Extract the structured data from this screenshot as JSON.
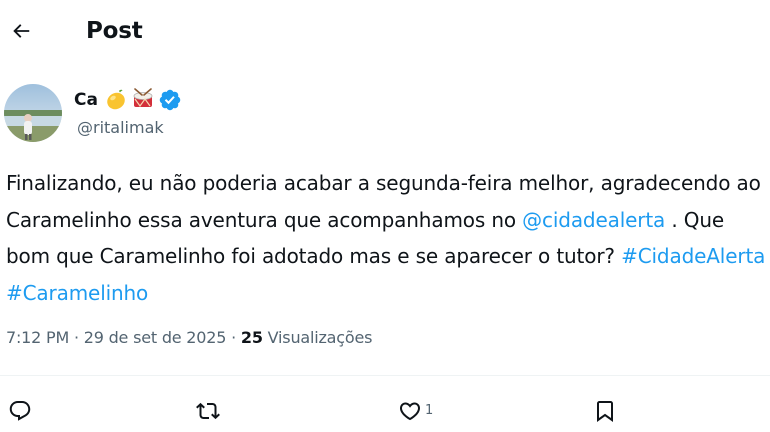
{
  "header": {
    "back_icon": "arrow-left-icon",
    "title": "Post"
  },
  "author": {
    "display_name": "Ca",
    "emojis": [
      "lemon-icon",
      "drum-icon"
    ],
    "verified_icon": "verified-badge-icon",
    "handle": "@ritalimak"
  },
  "post": {
    "text_before_mention": "Finalizando,  eu não poderia acabar a segunda-feira melhor, agradecendo ao Caramelinho essa aventura que acompanhamos no ",
    "mention": "@cidadealerta",
    "text_after_mention": " . Que bom que Caramelinho foi adotado mas e se aparecer o tutor? ",
    "hashtag_1": "#CidadeAlerta",
    "hashtag_separator": " ",
    "hashtag_2": "#Caramelinho"
  },
  "meta": {
    "time": "7:12 PM",
    "separator": " · ",
    "date": "29 de set de 2025",
    "separator_2": " · ",
    "views_count": "25",
    "views_label": " Visualizações"
  },
  "actions": {
    "reply_icon": "reply-icon",
    "repost_icon": "repost-icon",
    "like_icon": "like-icon",
    "like_count": "1",
    "bookmark_icon": "bookmark-icon"
  },
  "colors": {
    "text": "#0f1419",
    "secondary": "#536471",
    "link": "#1d9bf0",
    "verified": "#1d9bf0",
    "divider": "#eff3f4"
  }
}
